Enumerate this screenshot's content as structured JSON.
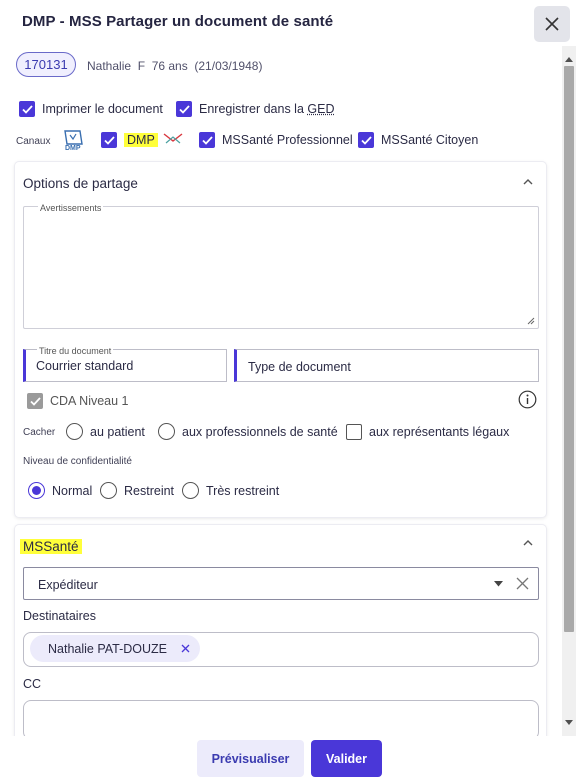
{
  "dialog": {
    "title": "DMP - MSS Partager un document de santé"
  },
  "patient": {
    "id": "170131",
    "info": "Nathalie  F  76 ans  (21/03/1948)"
  },
  "options": {
    "print_label": "Imprimer le document",
    "save_label_prefix": "Enregistrer dans la ",
    "save_label_ged": "GED"
  },
  "channels": {
    "label": "Canaux",
    "dmp_logo_text": "DMP",
    "dmp": "DMP",
    "mss_pro": "MSSanté Professionnel",
    "mss_citizen": "MSSanté Citoyen"
  },
  "sharing": {
    "title": "Options de partage",
    "warnings_label": "Avertissements",
    "doc_title_label": "Titre du document",
    "doc_title_value": "Courrier standard",
    "doc_type_placeholder": "Type de document",
    "cda_label": "CDA Niveau 1",
    "hide_label": "Cacher",
    "hide_patient": "au patient",
    "hide_professionals": "aux professionnels de santé",
    "hide_representatives": "aux représentants légaux",
    "confidentiality_label": "Niveau de confidentialité",
    "conf_normal": "Normal",
    "conf_restricted": "Restreint",
    "conf_very_restricted": "Très restreint"
  },
  "mss": {
    "title": "MSSanté",
    "sender_placeholder": "Expéditeur",
    "recipients_label": "Destinataires",
    "recipient_chip": "Nathalie PAT-DOUZE",
    "cc_label": "CC"
  },
  "footer": {
    "preview": "Prévisualiser",
    "validate": "Valider"
  },
  "colors": {
    "accent": "#4a37d8",
    "highlight": "#ffff3a",
    "checkbox_disabled": "#9a9a9a"
  }
}
